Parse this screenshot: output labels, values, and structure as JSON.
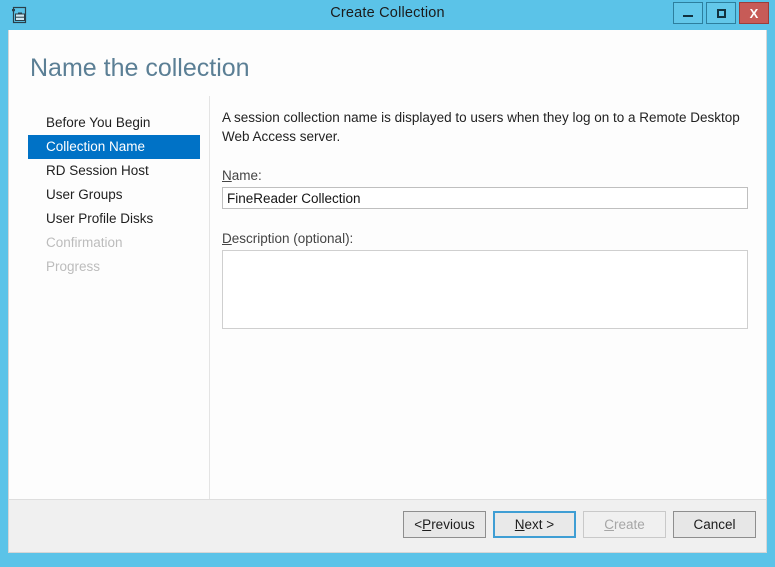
{
  "window": {
    "title": "Create Collection",
    "icon": "collection-window-icon",
    "controls": {
      "minimize": "minimize-icon",
      "maximize": "maximize-icon",
      "close": "X"
    },
    "accent_blue": "#5bc3e8",
    "close_red": "#c75b57"
  },
  "page": {
    "heading": "Name the collection"
  },
  "nav": {
    "items": [
      {
        "label": "Before You Begin",
        "state": "normal"
      },
      {
        "label": "Collection Name",
        "state": "selected"
      },
      {
        "label": "RD Session Host",
        "state": "normal"
      },
      {
        "label": "User Groups",
        "state": "normal"
      },
      {
        "label": "User Profile Disks",
        "state": "normal"
      },
      {
        "label": "Confirmation",
        "state": "disabled"
      },
      {
        "label": "Progress",
        "state": "disabled"
      }
    ],
    "selected_color": "#0072c6"
  },
  "main": {
    "description": "A session collection name is displayed to users when they log on to a Remote Desktop Web Access server.",
    "name_label_accel": "N",
    "name_label_rest": "ame:",
    "name_value": "FineReader Collection",
    "name_placeholder": "",
    "description_label_accel": "D",
    "description_label_rest": "escription (optional):",
    "description_value": "",
    "description_placeholder": ""
  },
  "footer": {
    "buttons": [
      {
        "prefix": "< ",
        "accel": "P",
        "rest": "revious",
        "state": "normal",
        "name": "previous-button"
      },
      {
        "prefix": "",
        "accel": "N",
        "rest": "ext >",
        "state": "focused",
        "name": "next-button"
      },
      {
        "prefix": "",
        "accel": "C",
        "rest": "reate",
        "state": "disabled",
        "name": "create-button"
      },
      {
        "prefix": "",
        "accel": "",
        "rest": "Cancel",
        "state": "normal",
        "name": "cancel-button"
      }
    ]
  }
}
